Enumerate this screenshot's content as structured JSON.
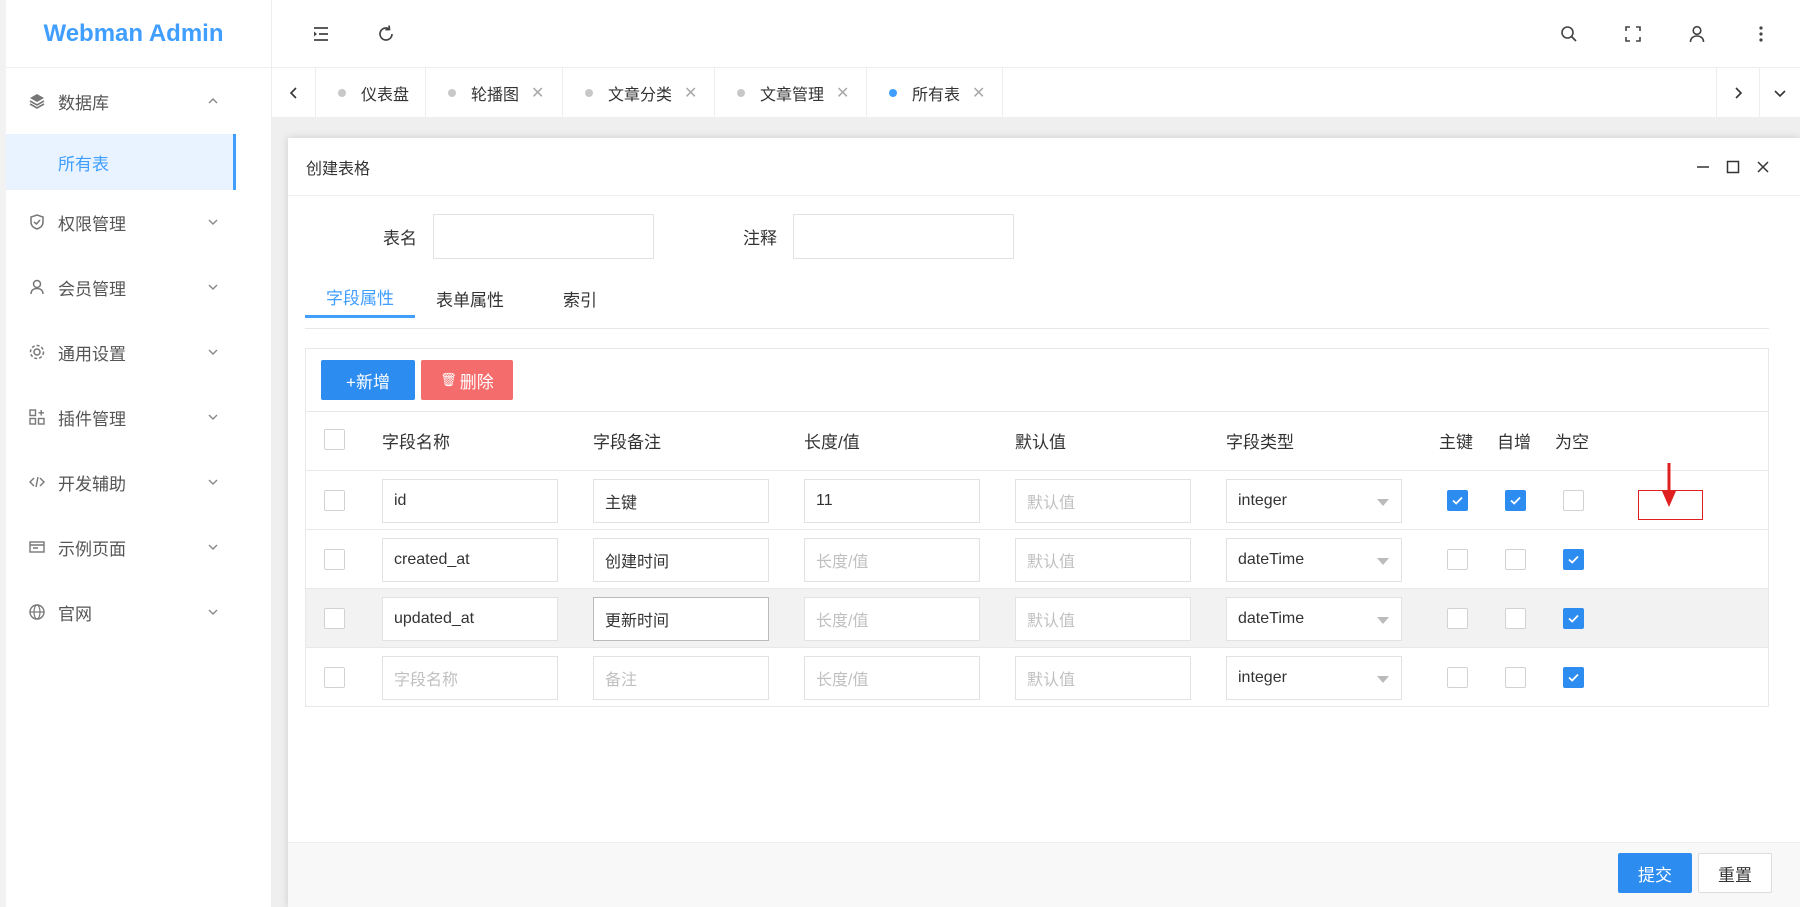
{
  "app": {
    "title": "Webman Admin"
  },
  "sidebar": {
    "items": [
      {
        "label": "数据库",
        "icon": "database-icon",
        "expanded": true
      },
      {
        "label": "权限管理",
        "icon": "shield-icon"
      },
      {
        "label": "会员管理",
        "icon": "user-icon"
      },
      {
        "label": "通用设置",
        "icon": "gear-icon"
      },
      {
        "label": "插件管理",
        "icon": "plugin-icon"
      },
      {
        "label": "开发辅助",
        "icon": "code-icon"
      },
      {
        "label": "示例页面",
        "icon": "template-icon"
      },
      {
        "label": "官网",
        "icon": "globe-icon"
      }
    ],
    "active_sub": "所有表"
  },
  "tabs": [
    {
      "label": "仪表盘",
      "closable": false
    },
    {
      "label": "轮播图",
      "closable": true
    },
    {
      "label": "文章分类",
      "closable": true
    },
    {
      "label": "文章管理",
      "closable": true
    },
    {
      "label": "所有表",
      "closable": true,
      "active": true
    }
  ],
  "modal": {
    "title": "创建表格",
    "form": {
      "table_name_label": "表名",
      "table_name_value": "",
      "comment_label": "注释",
      "comment_value": ""
    },
    "subtabs": [
      "字段属性",
      "表单属性",
      "索引"
    ],
    "buttons": {
      "add": "+新增",
      "delete": "删除",
      "submit": "提交",
      "reset": "重置"
    },
    "columns": [
      "字段名称",
      "字段备注",
      "长度/值",
      "默认值",
      "字段类型",
      "主键",
      "自增",
      "为空"
    ],
    "placeholders": {
      "name": "字段名称",
      "remark": "备注",
      "length": "长度/值",
      "default": "默认值"
    },
    "rows": [
      {
        "name": "id",
        "remark": "主键",
        "length": "11",
        "default": "",
        "type": "integer",
        "pk": true,
        "ai": true,
        "nullable": false
      },
      {
        "name": "created_at",
        "remark": "创建时间",
        "length": "",
        "default": "",
        "type": "dateTime",
        "pk": false,
        "ai": false,
        "nullable": true
      },
      {
        "name": "updated_at",
        "remark": "更新时间",
        "length": "",
        "default": "",
        "type": "dateTime",
        "pk": false,
        "ai": false,
        "nullable": true
      },
      {
        "name": "",
        "remark": "",
        "length": "",
        "default": "",
        "type": "integer",
        "pk": false,
        "ai": false,
        "nullable": true
      }
    ]
  },
  "colors": {
    "primary": "#409eff",
    "button_blue": "#2d8cf0",
    "danger": "#f56c6c",
    "annotation": "#e02020"
  }
}
